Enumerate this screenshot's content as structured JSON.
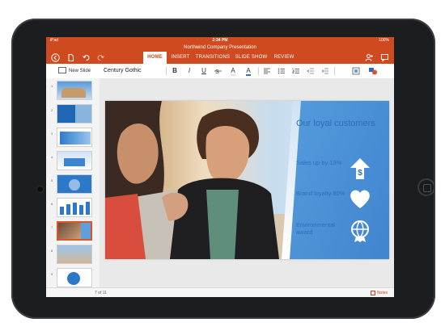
{
  "status": {
    "carrier": "iPad",
    "time": "2:34 PM",
    "battery": "100%"
  },
  "document": {
    "title": "Northwind Company Presentation"
  },
  "toolbar_icons": [
    "back-icon",
    "file-icon",
    "undo-icon",
    "redo-icon",
    "share-person-icon",
    "comment-icon"
  ],
  "tabs": [
    {
      "label": "HOME",
      "active": true
    },
    {
      "label": "INSERT",
      "active": false
    },
    {
      "label": "TRANSITIONS",
      "active": false
    },
    {
      "label": "SLIDE SHOW",
      "active": false
    },
    {
      "label": "REVIEW",
      "active": false
    }
  ],
  "ribbon": {
    "new_slide": "New Slide",
    "font": "Century Gothic",
    "bold": "B",
    "italic": "I",
    "underline": "U",
    "format_a": "A",
    "font_color_a": "A"
  },
  "thumbnails": {
    "selected_index": 7,
    "count": 9
  },
  "slide": {
    "heading": "Our loyal customers",
    "items": [
      {
        "label": "Sales up by 13%",
        "icon": "dollar-up-arrow-icon"
      },
      {
        "label": "Brand loyalty 80%",
        "icon": "heart-icon"
      },
      {
        "label": "Environmental award",
        "icon": "globe-award-icon"
      }
    ]
  },
  "footer": {
    "page_indicator": "7 of 11",
    "notes": "Notes"
  },
  "colors": {
    "accent": "#cf4a1f",
    "slide_blue": "#2c6fb8"
  }
}
